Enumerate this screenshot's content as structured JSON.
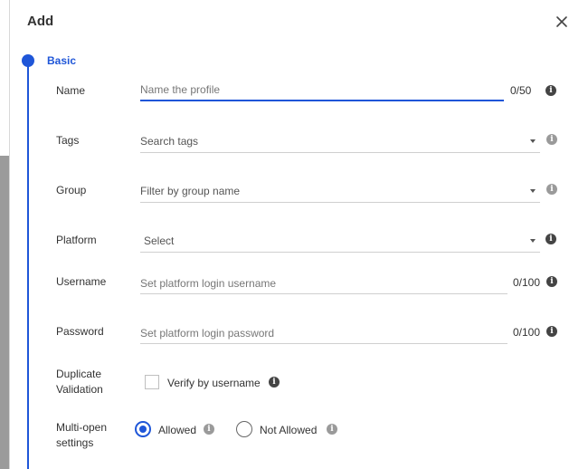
{
  "dialog": {
    "title": "Add",
    "section": "Basic"
  },
  "form": {
    "name": {
      "label": "Name",
      "placeholder": "Name the profile",
      "counter": "0/50"
    },
    "tags": {
      "label": "Tags",
      "placeholder": "Search tags"
    },
    "group": {
      "label": "Group",
      "placeholder": "Filter by group name"
    },
    "platform": {
      "label": "Platform",
      "placeholder": "Select"
    },
    "username": {
      "label": "Username",
      "placeholder": "Set platform login username",
      "counter": "0/100"
    },
    "password": {
      "label": "Password",
      "placeholder": "Set platform login password",
      "counter": "0/100"
    },
    "duplicate": {
      "label_line1": "Duplicate",
      "label_line2": "Validation",
      "option": "Verify by username",
      "checked": false
    },
    "multiopen": {
      "label_line1": "Multi-open",
      "label_line2": "settings",
      "options": [
        "Allowed",
        "Not Allowed"
      ],
      "selected": "Allowed"
    }
  },
  "icons": {
    "close": "close-icon",
    "info": "info-icon",
    "dropdown": "chevron-down-icon"
  },
  "colors": {
    "accent": "#1f56d8",
    "info_dark": "#444444",
    "info_light": "#9a9a9a"
  }
}
